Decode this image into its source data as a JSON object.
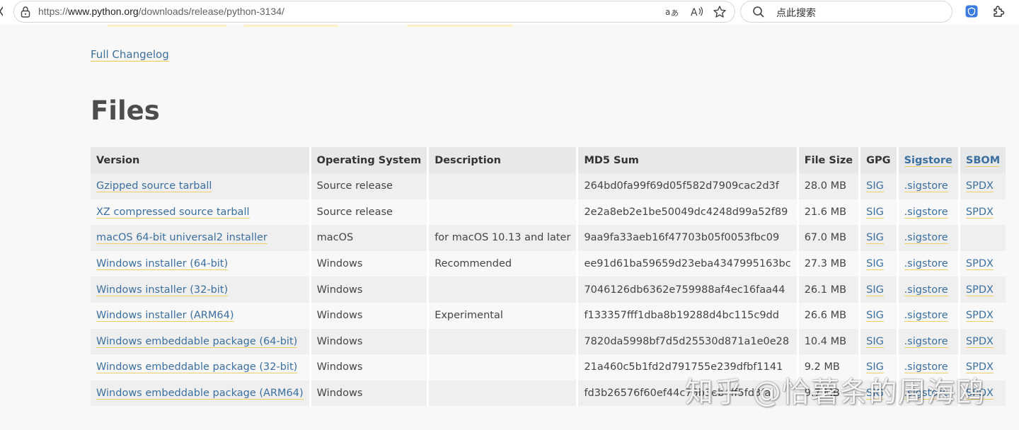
{
  "browser": {
    "url_prefix": "https://",
    "url_host": "www.python.org",
    "url_path": "/downloads/release/python-3134/",
    "search_placeholder": "点此搜索"
  },
  "page": {
    "changelog_link": "Full Changelog",
    "files_heading": "Files"
  },
  "table": {
    "headers": [
      "Version",
      "Operating System",
      "Description",
      "MD5 Sum",
      "File Size",
      "GPG",
      "Sigstore",
      "SBOM"
    ],
    "rows": [
      {
        "version": "Gzipped source tarball",
        "os": "Source release",
        "description": "",
        "md5": "264bd0fa99f69d05f582d7909cac2d3f",
        "size": "28.0 MB",
        "gpg": "SIG",
        "sigstore": ".sigstore",
        "sbom": "SPDX"
      },
      {
        "version": "XZ compressed source tarball",
        "os": "Source release",
        "description": "",
        "md5": "2e2a8eb2e1be50049dc4248d99a52f89",
        "size": "21.6 MB",
        "gpg": "SIG",
        "sigstore": ".sigstore",
        "sbom": "SPDX"
      },
      {
        "version": "macOS 64-bit universal2 installer",
        "os": "macOS",
        "description": "for macOS 10.13 and later",
        "md5": "9aa9fa33aeb16f47703b05f0053fbc09",
        "size": "67.0 MB",
        "gpg": "SIG",
        "sigstore": ".sigstore",
        "sbom": ""
      },
      {
        "version": "Windows installer (64-bit)",
        "os": "Windows",
        "description": "Recommended",
        "md5": "ee91d61ba59659d23eba4347995163bc",
        "size": "27.3 MB",
        "gpg": "SIG",
        "sigstore": ".sigstore",
        "sbom": "SPDX"
      },
      {
        "version": "Windows installer (32-bit)",
        "os": "Windows",
        "description": "",
        "md5": "7046126db6362e759988af4ec16faa44",
        "size": "26.1 MB",
        "gpg": "SIG",
        "sigstore": ".sigstore",
        "sbom": "SPDX"
      },
      {
        "version": "Windows installer (ARM64)",
        "os": "Windows",
        "description": "Experimental",
        "md5": "f133357fff1dba8b19288d4bc115c9dd",
        "size": "26.6 MB",
        "gpg": "SIG",
        "sigstore": ".sigstore",
        "sbom": "SPDX"
      },
      {
        "version": "Windows embeddable package (64-bit)",
        "os": "Windows",
        "description": "",
        "md5": "7820da5998bf7d5d25530d871a1e0e28",
        "size": "10.4 MB",
        "gpg": "SIG",
        "sigstore": ".sigstore",
        "sbom": "SPDX"
      },
      {
        "version": "Windows embeddable package (32-bit)",
        "os": "Windows",
        "description": "",
        "md5": "21a460c5b1fd2d791755e239dfbf1141",
        "size": "9.2 MB",
        "gpg": "SIG",
        "sigstore": ".sigstore",
        "sbom": "SPDX"
      },
      {
        "version": "Windows embeddable package (ARM64)",
        "os": "Windows",
        "description": "",
        "md5": "fd3b26576f60ef44c75b3eb4ff5fd3fa",
        "size": "9.7 MB",
        "gpg": "SIG",
        "sigstore": ".sigstore",
        "sbom": "SPDX"
      }
    ]
  },
  "watermark": "知乎 @恰薯条的周海鸥",
  "colors": {
    "link": "#3b6fa0",
    "link_underline": "#f0cf6a",
    "header_bg": "#e6e8ea",
    "row_odd": "#efefef",
    "row_even": "#f8f8f8"
  }
}
